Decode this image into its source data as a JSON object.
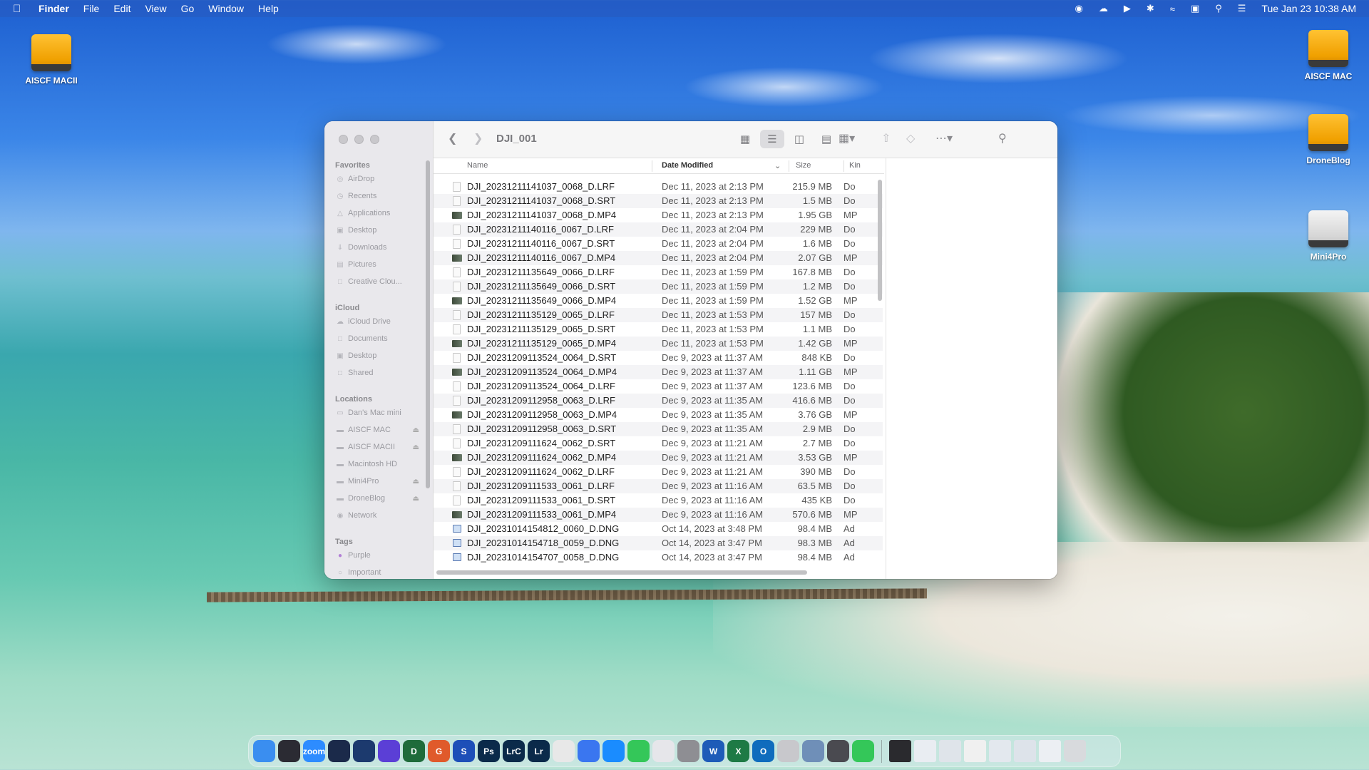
{
  "menubar": {
    "app": "Finder",
    "items": [
      "File",
      "Edit",
      "View",
      "Go",
      "Window",
      "Help"
    ],
    "clock": "Tue Jan 23  10:38 AM"
  },
  "desktop_icons": [
    {
      "label": "AISCF MACII",
      "icon": "external-drive-icon"
    },
    {
      "label": "AISCF MAC",
      "icon": "external-drive-icon"
    },
    {
      "label": "DroneBlog",
      "icon": "external-drive-icon"
    },
    {
      "label": "Mini4Pro",
      "icon": "removable-drive-icon"
    }
  ],
  "window": {
    "title": "DJI_001",
    "columns": {
      "name": "Name",
      "date": "Date Modified",
      "size": "Size",
      "kind": "Kin"
    }
  },
  "sidebar": {
    "favorites_header": "Favorites",
    "favorites": [
      "AirDrop",
      "Recents",
      "Applications",
      "Desktop",
      "Downloads",
      "Pictures",
      "Creative Clou..."
    ],
    "icloud_header": "iCloud",
    "icloud": [
      "iCloud Drive",
      "Documents",
      "Desktop",
      "Shared"
    ],
    "locations_header": "Locations",
    "locations": [
      "Dan's Mac mini",
      "AISCF MAC",
      "AISCF MACII",
      "Macintosh HD",
      "Mini4Pro",
      "DroneBlog",
      "Network"
    ],
    "tags_header": "Tags",
    "tags": [
      "Purple",
      "Important"
    ]
  },
  "files": [
    {
      "name": "DJI_20231211141037_0068_D.LRF",
      "date": "Dec 11, 2023 at 2:13 PM",
      "size": "215.9 MB",
      "kind": "Do",
      "type": "doc"
    },
    {
      "name": "DJI_20231211141037_0068_D.SRT",
      "date": "Dec 11, 2023 at 2:13 PM",
      "size": "1.5 MB",
      "kind": "Do",
      "type": "doc"
    },
    {
      "name": "DJI_20231211141037_0068_D.MP4",
      "date": "Dec 11, 2023 at 2:13 PM",
      "size": "1.95 GB",
      "kind": "MP",
      "type": "video"
    },
    {
      "name": "DJI_20231211140116_0067_D.LRF",
      "date": "Dec 11, 2023 at 2:04 PM",
      "size": "229 MB",
      "kind": "Do",
      "type": "doc"
    },
    {
      "name": "DJI_20231211140116_0067_D.SRT",
      "date": "Dec 11, 2023 at 2:04 PM",
      "size": "1.6 MB",
      "kind": "Do",
      "type": "doc"
    },
    {
      "name": "DJI_20231211140116_0067_D.MP4",
      "date": "Dec 11, 2023 at 2:04 PM",
      "size": "2.07 GB",
      "kind": "MP",
      "type": "video"
    },
    {
      "name": "DJI_20231211135649_0066_D.LRF",
      "date": "Dec 11, 2023 at 1:59 PM",
      "size": "167.8 MB",
      "kind": "Do",
      "type": "doc"
    },
    {
      "name": "DJI_20231211135649_0066_D.SRT",
      "date": "Dec 11, 2023 at 1:59 PM",
      "size": "1.2 MB",
      "kind": "Do",
      "type": "doc"
    },
    {
      "name": "DJI_20231211135649_0066_D.MP4",
      "date": "Dec 11, 2023 at 1:59 PM",
      "size": "1.52 GB",
      "kind": "MP",
      "type": "video"
    },
    {
      "name": "DJI_20231211135129_0065_D.LRF",
      "date": "Dec 11, 2023 at 1:53 PM",
      "size": "157 MB",
      "kind": "Do",
      "type": "doc"
    },
    {
      "name": "DJI_20231211135129_0065_D.SRT",
      "date": "Dec 11, 2023 at 1:53 PM",
      "size": "1.1 MB",
      "kind": "Do",
      "type": "doc"
    },
    {
      "name": "DJI_20231211135129_0065_D.MP4",
      "date": "Dec 11, 2023 at 1:53 PM",
      "size": "1.42 GB",
      "kind": "MP",
      "type": "video"
    },
    {
      "name": "DJI_20231209113524_0064_D.SRT",
      "date": "Dec 9, 2023 at 11:37 AM",
      "size": "848 KB",
      "kind": "Do",
      "type": "doc"
    },
    {
      "name": "DJI_20231209113524_0064_D.MP4",
      "date": "Dec 9, 2023 at 11:37 AM",
      "size": "1.11 GB",
      "kind": "MP",
      "type": "video"
    },
    {
      "name": "DJI_20231209113524_0064_D.LRF",
      "date": "Dec 9, 2023 at 11:37 AM",
      "size": "123.6 MB",
      "kind": "Do",
      "type": "doc"
    },
    {
      "name": "DJI_20231209112958_0063_D.LRF",
      "date": "Dec 9, 2023 at 11:35 AM",
      "size": "416.6 MB",
      "kind": "Do",
      "type": "doc"
    },
    {
      "name": "DJI_20231209112958_0063_D.MP4",
      "date": "Dec 9, 2023 at 11:35 AM",
      "size": "3.76 GB",
      "kind": "MP",
      "type": "video"
    },
    {
      "name": "DJI_20231209112958_0063_D.SRT",
      "date": "Dec 9, 2023 at 11:35 AM",
      "size": "2.9 MB",
      "kind": "Do",
      "type": "doc"
    },
    {
      "name": "DJI_20231209111624_0062_D.SRT",
      "date": "Dec 9, 2023 at 11:21 AM",
      "size": "2.7 MB",
      "kind": "Do",
      "type": "doc"
    },
    {
      "name": "DJI_20231209111624_0062_D.MP4",
      "date": "Dec 9, 2023 at 11:21 AM",
      "size": "3.53 GB",
      "kind": "MP",
      "type": "video"
    },
    {
      "name": "DJI_20231209111624_0062_D.LRF",
      "date": "Dec 9, 2023 at 11:21 AM",
      "size": "390 MB",
      "kind": "Do",
      "type": "doc"
    },
    {
      "name": "DJI_20231209111533_0061_D.LRF",
      "date": "Dec 9, 2023 at 11:16 AM",
      "size": "63.5 MB",
      "kind": "Do",
      "type": "doc"
    },
    {
      "name": "DJI_20231209111533_0061_D.SRT",
      "date": "Dec 9, 2023 at 11:16 AM",
      "size": "435 KB",
      "kind": "Do",
      "type": "doc"
    },
    {
      "name": "DJI_20231209111533_0061_D.MP4",
      "date": "Dec 9, 2023 at 11:16 AM",
      "size": "570.6 MB",
      "kind": "MP",
      "type": "video"
    },
    {
      "name": "DJI_20231014154812_0060_D.DNG",
      "date": "Oct 14, 2023 at 3:48 PM",
      "size": "98.4 MB",
      "kind": "Ad",
      "type": "dng"
    },
    {
      "name": "DJI_20231014154718_0059_D.DNG",
      "date": "Oct 14, 2023 at 3:47 PM",
      "size": "98.3 MB",
      "kind": "Ad",
      "type": "dng"
    },
    {
      "name": "DJI_20231014154707_0058_D.DNG",
      "date": "Oct 14, 2023 at 3:47 PM",
      "size": "98.4 MB",
      "kind": "Ad",
      "type": "dng"
    }
  ],
  "dock": {
    "apps": [
      {
        "icon": "finder-icon",
        "label": "",
        "color": "#3a8ef0"
      },
      {
        "icon": "davinci-resolve-icon",
        "label": "",
        "color": "#2b2b33"
      },
      {
        "icon": "zoom-icon",
        "label": "zoom",
        "color": "#2d8cff"
      },
      {
        "icon": "affinity-photo-icon",
        "label": "",
        "color": "#1b2a4a"
      },
      {
        "icon": "affinity-designer-icon",
        "label": "",
        "color": "#1c3a6e"
      },
      {
        "icon": "proton-vpn-icon",
        "label": "",
        "color": "#5b3fd6"
      },
      {
        "icon": "dxo-icon",
        "label": "D",
        "color": "#1f6b3a"
      },
      {
        "icon": "grammarly-icon",
        "label": "G",
        "color": "#e05a2b"
      },
      {
        "icon": "skylum-icon",
        "label": "S",
        "color": "#1d4fb8"
      },
      {
        "icon": "photoshop-icon",
        "label": "Ps",
        "color": "#0b2a4a"
      },
      {
        "icon": "lightroom-classic-icon",
        "label": "LrC",
        "color": "#0b2a4a"
      },
      {
        "icon": "lightroom-icon",
        "label": "Lr",
        "color": "#0b2a4a"
      },
      {
        "icon": "chrome-icon",
        "label": "",
        "color": "#e8e8e8"
      },
      {
        "icon": "signal-icon",
        "label": "",
        "color": "#3a76f0"
      },
      {
        "icon": "app-store-icon",
        "label": "",
        "color": "#1a8cff"
      },
      {
        "icon": "messages-icon",
        "label": "",
        "color": "#34c759"
      },
      {
        "icon": "launchpad-icon",
        "label": "",
        "color": "#e6e6ea"
      },
      {
        "icon": "system-settings-icon",
        "label": "",
        "color": "#8e8e93"
      },
      {
        "icon": "word-icon",
        "label": "W",
        "color": "#1e5bb8"
      },
      {
        "icon": "excel-icon",
        "label": "X",
        "color": "#1e7a45"
      },
      {
        "icon": "outlook-icon",
        "label": "O",
        "color": "#0f6cbd"
      },
      {
        "icon": "disk-utility-icon",
        "label": "",
        "color": "#c8c8cc"
      },
      {
        "icon": "preview-icon",
        "label": "",
        "color": "#6f8fb8"
      },
      {
        "icon": "quicktime-icon",
        "label": "",
        "color": "#4a4a50"
      },
      {
        "icon": "facetime-icon",
        "label": "",
        "color": "#34c759"
      }
    ],
    "docs": [
      {
        "icon": "downloads-stack-icon",
        "color": "#2a2a2e"
      },
      {
        "icon": "document-thumbnail-icon",
        "color": "#e9edf2"
      },
      {
        "icon": "document-thumbnail-icon",
        "color": "#dfe4ea"
      },
      {
        "icon": "document-thumbnail-icon",
        "color": "#f0f0f0"
      },
      {
        "icon": "document-thumbnail-icon",
        "color": "#e3e8ee"
      },
      {
        "icon": "document-thumbnail-icon",
        "color": "#dde3ea"
      },
      {
        "icon": "document-thumbnail-icon",
        "color": "#eceff3"
      }
    ],
    "trash": {
      "icon": "trash-icon",
      "color": "#d8dadd"
    }
  }
}
